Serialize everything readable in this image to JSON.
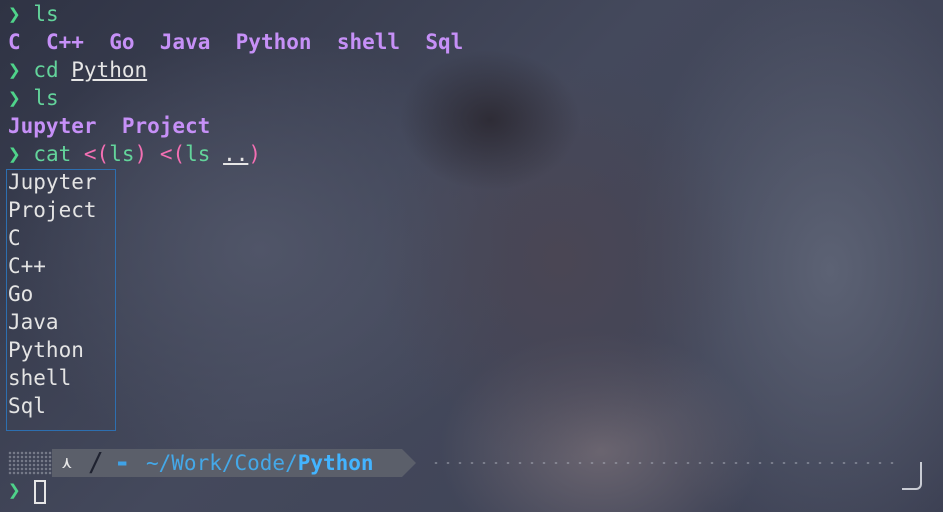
{
  "prompt_symbol": "❯",
  "history": [
    {
      "cmd": "ls"
    },
    {
      "dirs": [
        "C",
        "C++",
        "Go",
        "Java",
        "Python",
        "shell",
        "Sql"
      ]
    },
    {
      "cmd": "cd",
      "arg": "Python"
    },
    {
      "cmd": "ls"
    },
    {
      "dirs": [
        "Jupyter",
        "Project"
      ]
    },
    {
      "cmd": "cat",
      "open1": "<(",
      "inner1": "ls",
      "close1": ")",
      "open2": "<(",
      "inner2": "ls",
      "arg2": "..",
      "close2": ")"
    }
  ],
  "cat_output": [
    "Jupyter",
    "Project",
    "C",
    "C++",
    "Go",
    "Java",
    "Python",
    "shell",
    "Sql"
  ],
  "status_bar": {
    "vcs_icon": "⋏",
    "separator": "/",
    "folder_icon": "▬",
    "path_prefix": "~/Work/Code/",
    "current_dir": "Python"
  },
  "colors": {
    "prompt": "#4fd38a",
    "directory": "#c690f7",
    "path": "#43b4ff",
    "process_substitution": "#f36fb3"
  }
}
